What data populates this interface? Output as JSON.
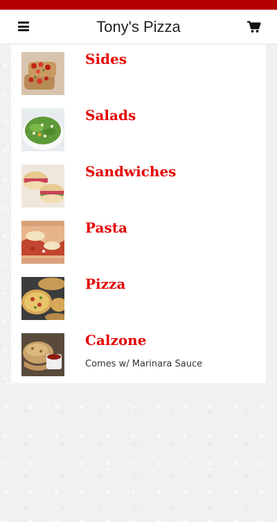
{
  "header": {
    "title": "Tony's Pizza",
    "menu_icon": "hamburger-menu-icon",
    "cart_icon": "shopping-cart-icon"
  },
  "colors": {
    "brand_red": "#b50000",
    "item_title_red": "#e60000"
  },
  "menu": {
    "items": [
      {
        "name": "Sides",
        "description": ""
      },
      {
        "name": "Salads",
        "description": ""
      },
      {
        "name": "Sandwiches",
        "description": ""
      },
      {
        "name": "Pasta",
        "description": ""
      },
      {
        "name": "Pizza",
        "description": ""
      },
      {
        "name": "Calzone",
        "description": "Comes w/ Marinara Sauce"
      }
    ]
  }
}
